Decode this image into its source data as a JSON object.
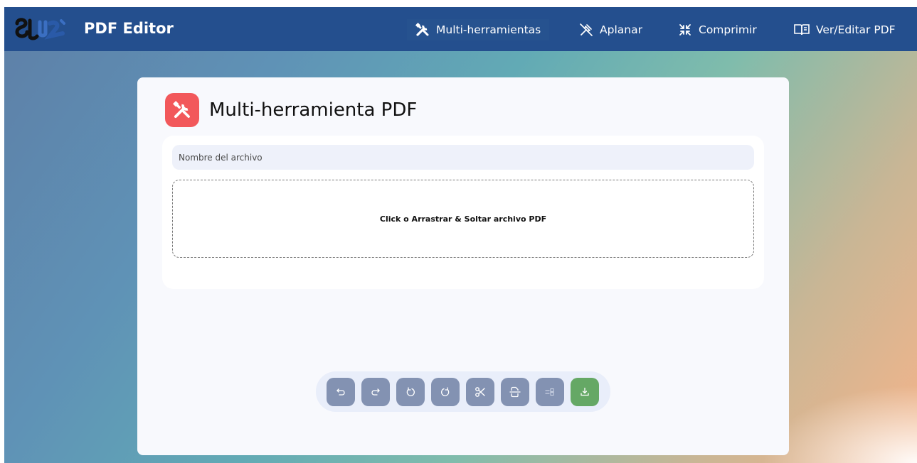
{
  "app": {
    "brand": "PDF Editor",
    "logo_text": "SRV"
  },
  "nav": {
    "items": [
      {
        "label": "Multi-herramientas",
        "icon": "tools-icon",
        "active": true
      },
      {
        "label": "Aplanar",
        "icon": "flatten-icon"
      },
      {
        "label": "Comprimir",
        "icon": "compress-icon"
      },
      {
        "label": "Ver/Editar PDF",
        "icon": "book-icon"
      }
    ]
  },
  "card": {
    "title": "Multi-herramienta PDF",
    "icon": "tools-icon",
    "filename_placeholder": "Nombre del archivo",
    "dropzone_text": "Click  o  Arrastrar & Soltar archivo PDF"
  },
  "toolbar": {
    "buttons": [
      "undo-icon",
      "redo-icon",
      "rotate-left-icon",
      "rotate-right-icon",
      "scissors-icon",
      "split-icon",
      "select-mode-icon",
      "download-icon"
    ]
  },
  "colors": {
    "navbar": "#244f8e",
    "tool_icon_bg": "#f2585b",
    "toolbar_button": "#8392b2",
    "download_button": "#65a865"
  }
}
